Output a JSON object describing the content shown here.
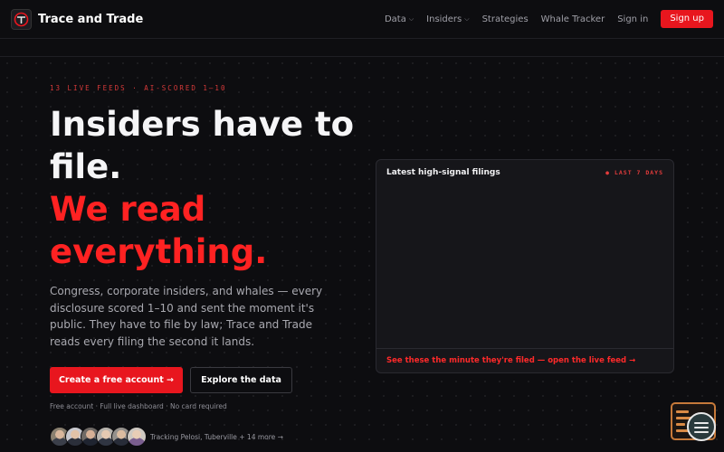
{
  "header": {
    "brand": "Trace and Trade",
    "nav": [
      {
        "label": "Data",
        "dropdown": true
      },
      {
        "label": "Insiders",
        "dropdown": true
      },
      {
        "label": "Strategies",
        "dropdown": false
      },
      {
        "label": "Whale Tracker",
        "dropdown": false
      },
      {
        "label": "Sign in",
        "dropdown": false
      }
    ],
    "signup_label": "Sign up"
  },
  "hero": {
    "eyebrow": "13 LIVE FEEDS · AI-SCORED 1–10",
    "headline_line1": "Insiders have to",
    "headline_line2": "file.",
    "headline_red1": "We read",
    "headline_red2": "everything.",
    "description": "Congress, corporate insiders, and whales — every disclosure scored 1–10 and sent the moment it's public. They have to file by law; Trace and Trade reads every filing the second it lands.",
    "cta_primary": "Create a free account →",
    "cta_secondary": "Explore the data",
    "fineprint": "Free account · Full live dashboard · No card required",
    "tracking": "Tracking Pelosi, Tuberville + 14 more →"
  },
  "panel": {
    "title": "Latest high-signal filings",
    "tag": "● LAST 7 DAYS",
    "link": "See these the minute they're filed — open the live feed →"
  },
  "colors": {
    "accent": "#e8161e",
    "background": "#0d0d10",
    "panel": "#16161a"
  }
}
